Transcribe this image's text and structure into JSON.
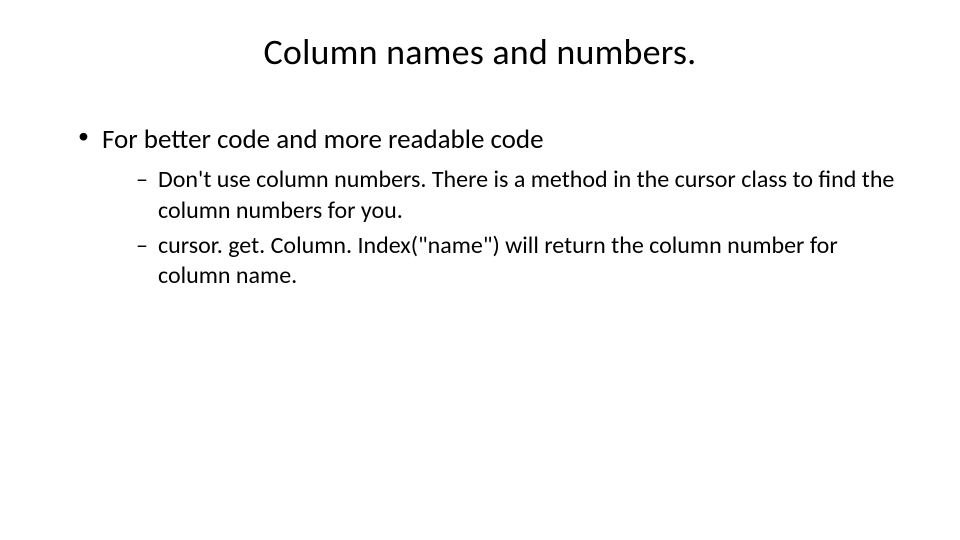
{
  "slide": {
    "title": "Column names and numbers.",
    "bullets": [
      {
        "text": "For better code and more readable code",
        "children": [
          {
            "text": "Don't use column numbers.  There is a method in the cursor class to find the column numbers for you."
          },
          {
            "text": "cursor. get. Column. Index(\"name\") will return the column number for column name."
          }
        ]
      }
    ]
  }
}
